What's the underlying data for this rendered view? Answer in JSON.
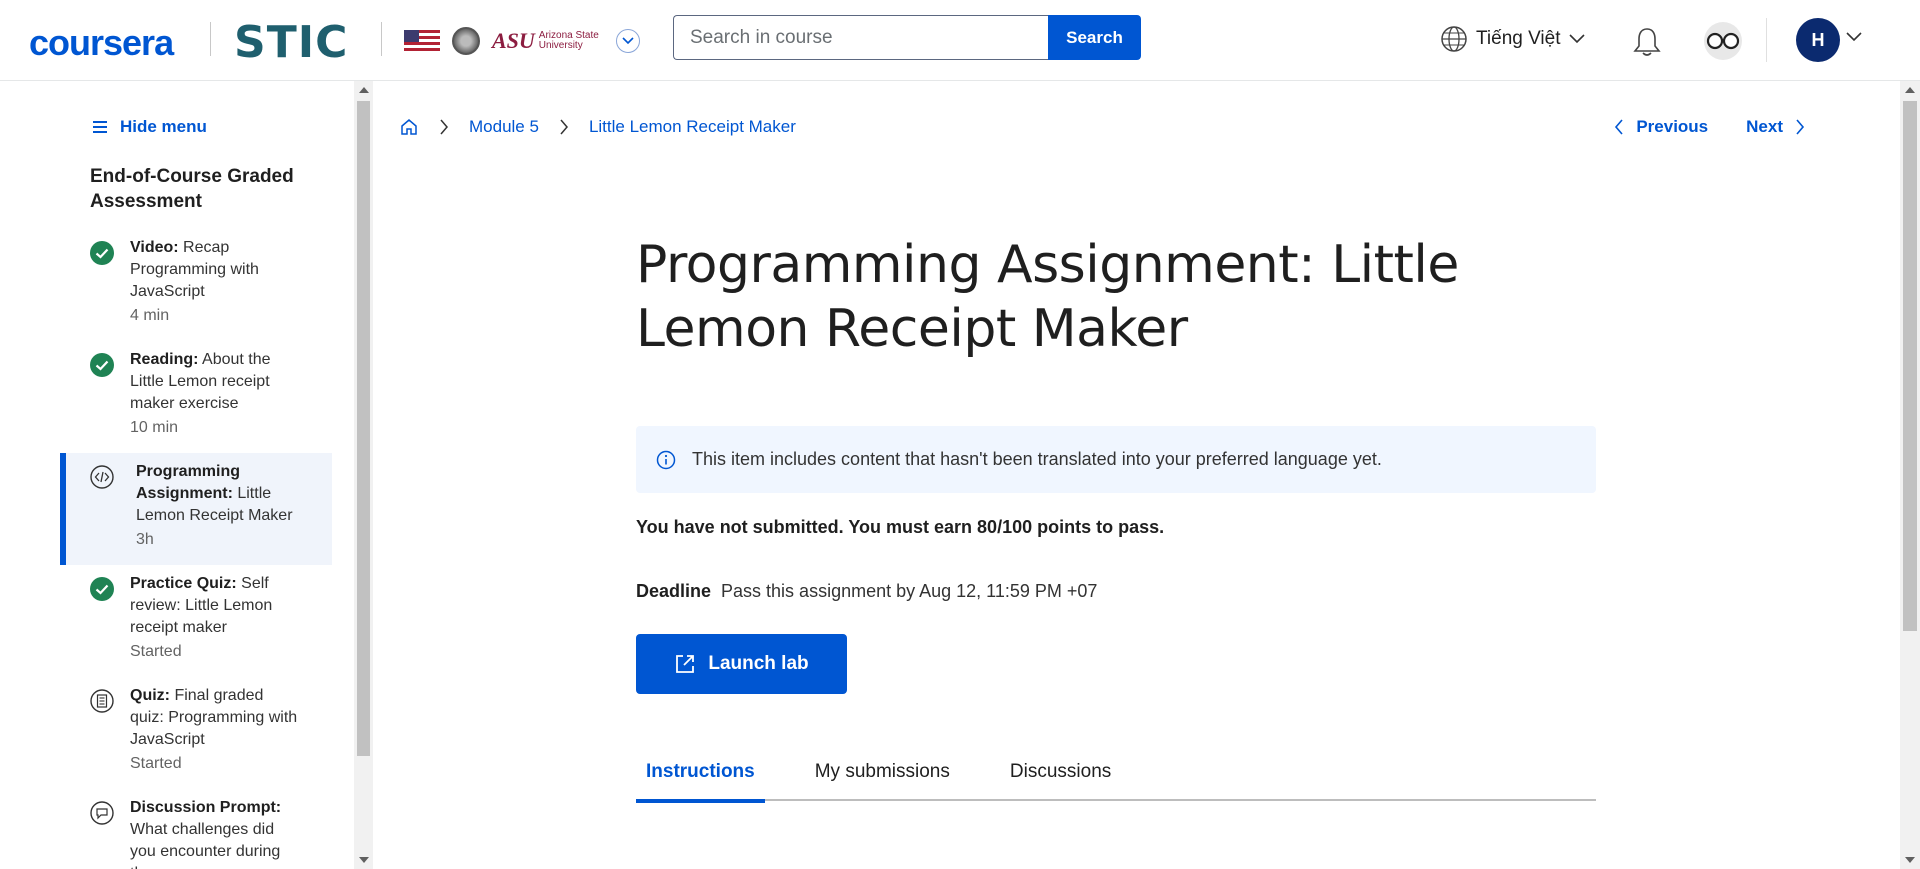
{
  "header": {
    "brand": "coursera",
    "partner": "STIC",
    "asu_mark": "ASU",
    "asu_text_1": "Arizona State",
    "asu_text_2": "University",
    "search_placeholder": "Search in course",
    "search_label": "Search",
    "language": "Tiếng Việt",
    "avatar_initial": "H"
  },
  "sidebar": {
    "hide_menu": "Hide menu",
    "course_title": "End-of-Course Graded Assessment",
    "items": [
      {
        "type": "Video:",
        "title": " Recap Programming with JavaScript",
        "meta": "4 min",
        "icon": "check-circle-icon"
      },
      {
        "type": "Reading:",
        "title": " About the Little Lemon receipt maker exercise",
        "meta": "10 min",
        "icon": "check-circle-icon"
      },
      {
        "type": "Programming Assignment:",
        "title": " Little Lemon Receipt Maker",
        "meta": "3h",
        "icon": "code-icon"
      },
      {
        "type": "Practice Quiz:",
        "title": " Self review: Little Lemon receipt maker",
        "meta": "Started",
        "icon": "check-circle-icon"
      },
      {
        "type": "Quiz:",
        "title": " Final graded quiz: Programming with JavaScript",
        "meta": "Started",
        "icon": "quiz-icon"
      },
      {
        "type": "Discussion Prompt:",
        "title": " What challenges did you encounter during the",
        "meta": "",
        "icon": "discussion-icon"
      }
    ]
  },
  "breadcrumb": {
    "module": "Module 5",
    "item": "Little Lemon Receipt Maker"
  },
  "nav": {
    "previous": "Previous",
    "next": "Next"
  },
  "main": {
    "title": "Programming Assignment: Little Lemon Receipt Maker",
    "notice": "This item includes content that hasn't been translated into your preferred language yet.",
    "status": "You have not submitted. You must earn 80/100 points to pass.",
    "deadline_label": "Deadline",
    "deadline_value": "Pass this assignment by Aug 12, 11:59 PM +07",
    "launch_label": "Launch lab",
    "tabs": [
      "Instructions",
      "My submissions",
      "Discussions"
    ]
  },
  "colors": {
    "accent": "#0056d2",
    "success": "#1f8354"
  }
}
